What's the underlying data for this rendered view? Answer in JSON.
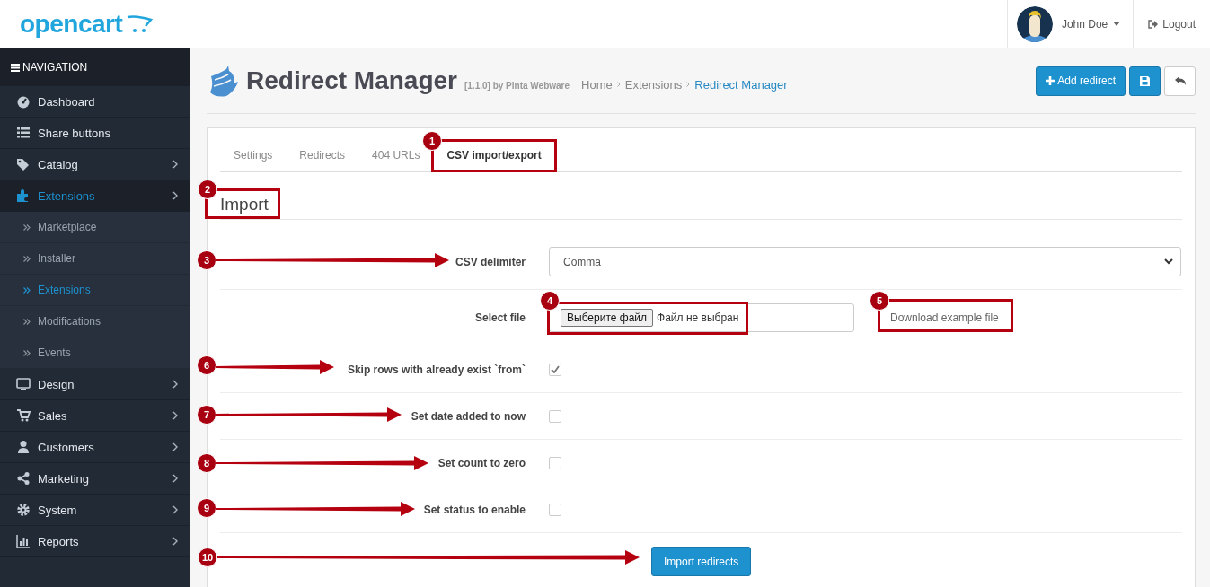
{
  "header": {
    "logo": "opencart",
    "user": {
      "name": "John Doe"
    },
    "logout": "Logout"
  },
  "sidebar": {
    "title": "NAVIGATION",
    "items": [
      {
        "label": "Dashboard",
        "expandable": false,
        "selected": false
      },
      {
        "label": "Share buttons",
        "expandable": false,
        "selected": false
      },
      {
        "label": "Catalog",
        "expandable": true,
        "selected": false
      },
      {
        "label": "Extensions",
        "expandable": true,
        "selected": true,
        "expanded": true,
        "children": [
          {
            "label": "Marketplace",
            "selected": false
          },
          {
            "label": "Installer",
            "selected": false
          },
          {
            "label": "Extensions",
            "selected": true
          },
          {
            "label": "Modifications",
            "selected": false
          },
          {
            "label": "Events",
            "selected": false
          }
        ]
      },
      {
        "label": "Design",
        "expandable": true,
        "selected": false
      },
      {
        "label": "Sales",
        "expandable": true,
        "selected": false
      },
      {
        "label": "Customers",
        "expandable": true,
        "selected": false
      },
      {
        "label": "Marketing",
        "expandable": true,
        "selected": false
      },
      {
        "label": "System",
        "expandable": true,
        "selected": false
      },
      {
        "label": "Reports",
        "expandable": true,
        "selected": false
      }
    ]
  },
  "page": {
    "title": "Redirect Manager",
    "version": "[1.1.0] by Pinta Webware",
    "breadcrumb": [
      "Home",
      "Extensions",
      "Redirect Manager"
    ],
    "add_button": "Add redirect"
  },
  "tabs": [
    {
      "label": "Settings",
      "selected": false
    },
    {
      "label": "Redirects",
      "selected": false
    },
    {
      "label": "404 URLs",
      "selected": false
    },
    {
      "label": "CSV import/export",
      "selected": true
    }
  ],
  "section_title": "Import",
  "form": {
    "delimiter": {
      "label": "CSV delimiter",
      "value": "Comma"
    },
    "file": {
      "label": "Select file",
      "button": "Выберите файл",
      "status": "Файл не выбран",
      "link": "Download example file"
    },
    "options": [
      {
        "label": "Skip rows with already exist `from`",
        "checked": true
      },
      {
        "label": "Set date added to now",
        "checked": false
      },
      {
        "label": "Set count to zero",
        "checked": false
      },
      {
        "label": "Set status to enable",
        "checked": false
      }
    ],
    "submit": "Import redirects"
  },
  "annotations": [
    {
      "number": "1",
      "kind": "box"
    },
    {
      "number": "2",
      "kind": "box"
    },
    {
      "number": "3",
      "kind": "arrow"
    },
    {
      "number": "4",
      "kind": "box"
    },
    {
      "number": "5",
      "kind": "box"
    },
    {
      "number": "6",
      "kind": "arrow"
    },
    {
      "number": "7",
      "kind": "arrow"
    },
    {
      "number": "8",
      "kind": "arrow"
    },
    {
      "number": "9",
      "kind": "arrow"
    },
    {
      "number": "10",
      "kind": "arrow"
    }
  ]
}
